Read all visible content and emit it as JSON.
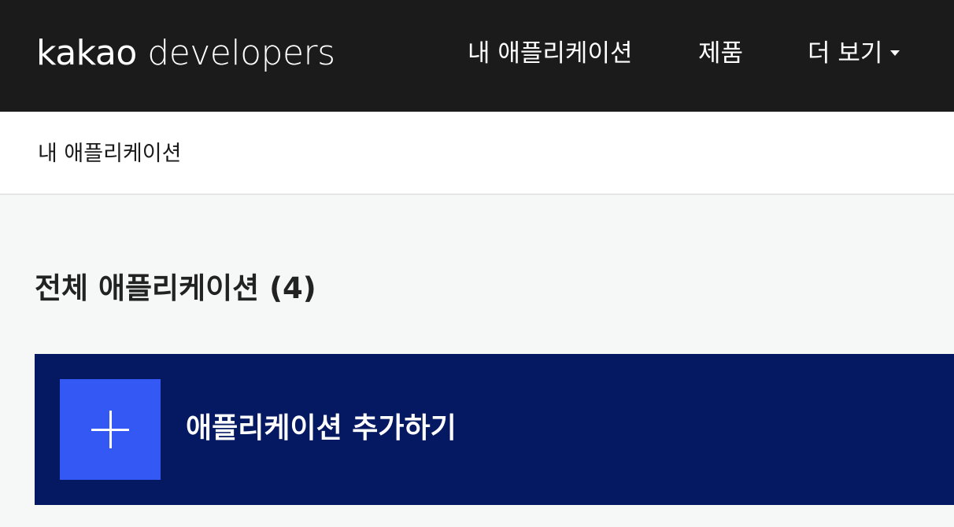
{
  "header": {
    "logo_brand": "kakao",
    "logo_suffix": "developers",
    "nav": {
      "apps": "내 애플리케이션",
      "products": "제품",
      "more": "더 보기"
    }
  },
  "breadcrumb": {
    "current": "내 애플리케이션"
  },
  "main": {
    "section_title": "전체 애플리케이션 (4)",
    "add_app": {
      "label": "애플리케이션 추가하기",
      "icon": "plus-icon"
    }
  },
  "colors": {
    "header_bg": "#1b1b1c",
    "card_bg": "#041962",
    "accent": "#3358f4",
    "page_bg": "#f6f7f7"
  }
}
